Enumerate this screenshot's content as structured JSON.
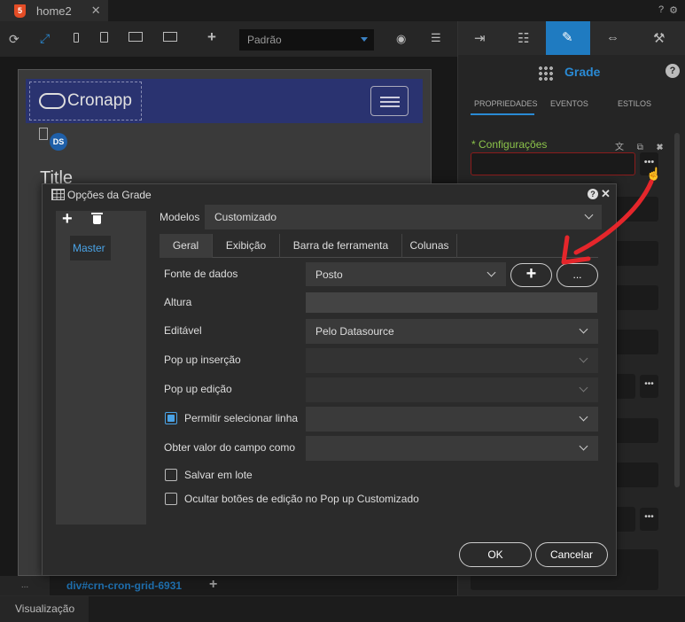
{
  "editor_tab": {
    "label": "home2",
    "close": "✕"
  },
  "top_right_icons": {
    "help": "?",
    "gear": "⚙"
  },
  "toolbar": {
    "device_select": "Padrão",
    "icons": [
      "refresh-icon",
      "expand-icon",
      "phone-icon",
      "tablet-icon",
      "desktop-icon",
      "monitor-icon",
      "add-icon",
      "eye-off-icon",
      "database-icon"
    ]
  },
  "canvas": {
    "logo_text": "Cronapp",
    "ds_badge": "DS",
    "title_text": "Title"
  },
  "breadcrumb": {
    "dots": "...",
    "path": "div#crn-cron-grid-6931",
    "add": "+"
  },
  "status_bar": {
    "tab": "Visualização"
  },
  "right_panel": {
    "component_title": "Grade",
    "help": "?",
    "subtabs": [
      "PROPRIEDADES",
      "EVENTOS",
      "ESTILOS"
    ],
    "config_label": "* Configurações",
    "config_icons": "文 ⧉ ✖",
    "more": "•••"
  },
  "dialog": {
    "title": "Opções da Grade",
    "help": "?",
    "close": "✕",
    "add": "+",
    "models": [
      "Master"
    ],
    "modelos_label": "Modelos",
    "modelos_value": "Customizado",
    "tabs": [
      "Geral",
      "Exibição",
      "Barra de ferramenta",
      "Colunas"
    ],
    "fields": {
      "fonte_label": "Fonte de dados",
      "fonte_value": "Posto",
      "fonte_add": "+",
      "fonte_more": "...",
      "altura_label": "Altura",
      "altura_value": "",
      "editavel_label": "Editável",
      "editavel_value": "Pelo Datasource",
      "popup_insercao_label": "Pop up inserção",
      "popup_edicao_label": "Pop up edição",
      "permitir_label": "Permitir selecionar linha",
      "obter_label": "Obter valor do campo como",
      "salvar_label": "Salvar em lote",
      "ocultar_label": "Ocultar botões de edição no Pop up Customizado"
    },
    "ok": "OK",
    "cancel": "Cancelar"
  }
}
